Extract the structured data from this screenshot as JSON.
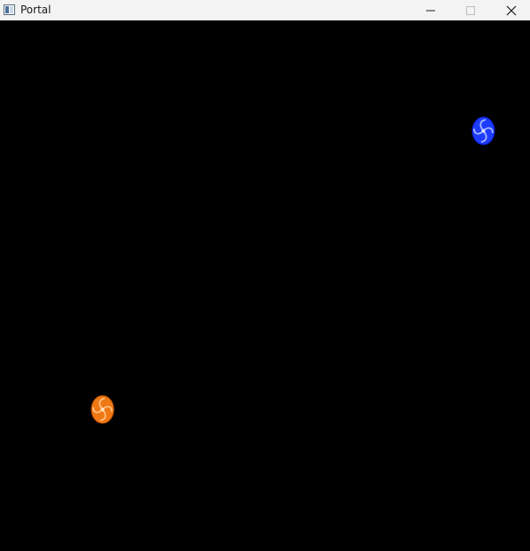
{
  "window": {
    "title": "Portal",
    "controls": {
      "minimize_icon": "minimize-icon",
      "maximize_icon": "maximize-icon",
      "close_icon": "close-icon"
    }
  },
  "game": {
    "background_color": "#000000",
    "portals": [
      {
        "name": "blue-portal",
        "color": "#1e3cff",
        "highlight": "#a8b8ff"
      },
      {
        "name": "orange-portal",
        "color": "#f07814",
        "highlight": "#ffc080"
      }
    ]
  }
}
